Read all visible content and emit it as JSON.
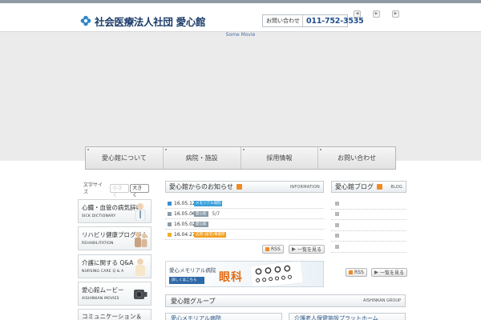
{
  "header": {
    "org_name": "社会医療法人社団 愛心館",
    "contact_label": "お問い合わせ",
    "phone": "011-752-3535",
    "nav_prev": "◀",
    "nav_next": "▶"
  },
  "movie": {
    "label": "Some Movie"
  },
  "global_nav": [
    {
      "label": "愛心館について"
    },
    {
      "label": "病院・施設"
    },
    {
      "label": "採用情報"
    },
    {
      "label": "お問い合わせ"
    }
  ],
  "font_size": {
    "label": "文字サイズ",
    "small": "小さく",
    "big": "大きく"
  },
  "side_banners": [
    {
      "title": "心臓・血管の病気辞典",
      "sub": "SICK DICTIONARY"
    },
    {
      "title": "リハビリ健康プログラム",
      "sub": "REHABILITATION"
    },
    {
      "title": "介護に関する Q&A",
      "sub": "NURSING CARE Q & A"
    },
    {
      "title": "愛心館ムービー",
      "sub": "AISHINKAN MOVIES"
    },
    {
      "title": "コミュニケーション＆",
      "sub": ""
    }
  ],
  "news": {
    "title": "愛心館からのお知らせ",
    "en": "INFORMATION",
    "rss": "RSS",
    "more": "一覧を見る",
    "items": [
      {
        "date": "16.05.12",
        "tag": "メモリアル病院",
        "tag_color": "#3aa0dc",
        "text": "",
        "icon_color": "#3a8fd0"
      },
      {
        "date": "16.05.06",
        "tag": "愛心館",
        "tag_color": "#8a9aa8",
        "text": "5/7",
        "icon_color": "#8a9aa8"
      },
      {
        "date": "16.05.02",
        "tag": "愛心館",
        "tag_color": "#8a9aa8",
        "text": "",
        "icon_color": "#8a9aa8"
      },
      {
        "date": "16.04.27",
        "tag": "訪問 (居宅)事業所",
        "tag_color": "#f0a020",
        "text": "",
        "icon_color": "#f0b030"
      }
    ]
  },
  "blog": {
    "title": "愛心館ブログ",
    "en": "BLOG",
    "rss": "RSS",
    "more": "一覧を見る",
    "rows": 5
  },
  "eye_banner": {
    "title": "愛心メモリアル病院",
    "cta": "詳しくはこちら",
    "big": "眼科"
  },
  "group": {
    "title": "愛心館グループ",
    "en": "AISHINKAN GROUP",
    "cards": [
      "愛心メモリアル病院",
      "介護老人保健施設プラットホーム"
    ]
  },
  "colors": {
    "brand": "#1b3b6a",
    "accent": "#2f6aa8",
    "rss": "#f08a24"
  }
}
